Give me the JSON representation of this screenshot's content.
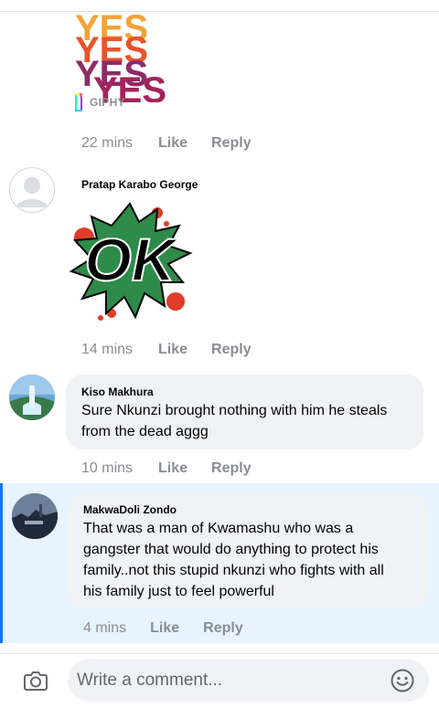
{
  "gif": {
    "text": "YES",
    "badge_label": "GIPHY"
  },
  "actions": {
    "like": "Like",
    "reply": "Reply"
  },
  "comments": [
    {
      "time": "22 mins"
    },
    {
      "author": "Pratap Karabo George",
      "sticker_text": "OK",
      "time": "14 mins"
    },
    {
      "author": "Kiso Makhura",
      "text_lines": [
        "Sure Nkunzi brought nothing with him he steals",
        "from the dead aggg"
      ],
      "time": "10 mins"
    },
    {
      "author": "MakwaDoli Zondo",
      "text_lines": [
        "That was a man of Kwamashu who was a",
        "gangster that would do anything to protect his",
        "family..not this stupid nkunzi who fights with all",
        "his family just to feel powerful"
      ],
      "time": "4 mins",
      "highlighted": true
    }
  ],
  "composer": {
    "placeholder": "Write a comment...",
    "camera_icon": "camera-icon",
    "emoji_icon": "emoji-icon"
  },
  "colors": {
    "highlight": "#e7f3ff",
    "highlight_bar": "#1877f2",
    "bubble": "#f0f2f5",
    "meta": "#8a8d91"
  }
}
